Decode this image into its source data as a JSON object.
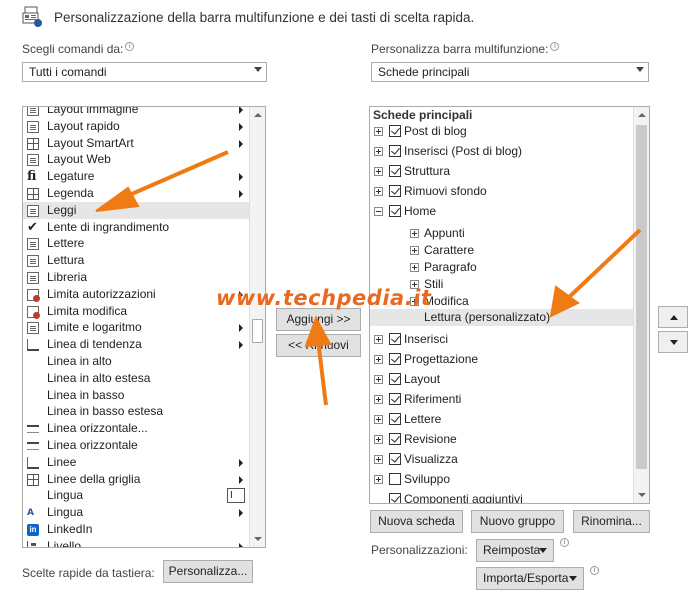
{
  "header": {
    "title": "Personalizzazione della barra multifunzione e dei tasti di scelta rapida."
  },
  "left": {
    "choose_label": "Scegli comandi da:",
    "combo_value": "Tutti i comandi",
    "items": [
      {
        "label": "Layout immagine",
        "icon": "image-layout-icon",
        "submenu": true
      },
      {
        "label": "Layout rapido",
        "icon": "quick-layout-icon",
        "submenu": true
      },
      {
        "label": "Layout SmartArt",
        "icon": "smartart-layout-icon",
        "submenu": true
      },
      {
        "label": "Layout Web",
        "icon": "web-layout-icon",
        "submenu": false
      },
      {
        "label": "Legature",
        "icon": "ligatures-icon",
        "submenu": true
      },
      {
        "label": "Legenda",
        "icon": "legend-icon",
        "submenu": true
      },
      {
        "label": "Leggi",
        "icon": "read-mode-icon",
        "submenu": false
      },
      {
        "label": "Lente di ingrandimento",
        "icon": "checkmark-icon",
        "submenu": false
      },
      {
        "label": "Lettere",
        "icon": "letters-icon",
        "submenu": false
      },
      {
        "label": "Lettura",
        "icon": "reading-icon",
        "submenu": false
      },
      {
        "label": "Libreria",
        "icon": "library-icon",
        "submenu": false
      },
      {
        "label": "Limita autorizzazioni",
        "icon": "restrict-permissions-icon",
        "submenu": true
      },
      {
        "label": "Limita modifica",
        "icon": "restrict-editing-icon",
        "submenu": false
      },
      {
        "label": "Limite e logaritmo",
        "icon": "limit-log-icon",
        "submenu": true
      },
      {
        "label": "Linea di tendenza",
        "icon": "trendline-icon",
        "submenu": true
      },
      {
        "label": "Linea in alto",
        "icon": "",
        "submenu": false
      },
      {
        "label": "Linea in alto estesa",
        "icon": "",
        "submenu": false
      },
      {
        "label": "Linea in basso",
        "icon": "",
        "submenu": false
      },
      {
        "label": "Linea in basso estesa",
        "icon": "",
        "submenu": false
      },
      {
        "label": "Linea orizzontale...",
        "icon": "horizontal-line-icon",
        "submenu": false
      },
      {
        "label": "Linea orizzontale",
        "icon": "horizontal-line-icon",
        "submenu": false
      },
      {
        "label": "Linee",
        "icon": "lines-icon",
        "submenu": true
      },
      {
        "label": "Linee della griglia",
        "icon": "gridlines-icon",
        "submenu": true
      },
      {
        "label": "Lingua",
        "icon": "",
        "submenu": false
      },
      {
        "label": "Lingua",
        "icon": "language-icon",
        "submenu": true
      },
      {
        "label": "LinkedIn",
        "icon": "linkedin-icon",
        "submenu": false
      },
      {
        "label": "Livello",
        "icon": "level-icon",
        "submenu": true
      }
    ],
    "selected_index": 6,
    "language_picker_glyph": "I"
  },
  "middle": {
    "add_button": "Aggiungi >>",
    "remove_button": "<< Rimuovi"
  },
  "right": {
    "customize_label": "Personalizza barra multifunzione:",
    "combo_value": "Schede principali",
    "tree_header": "Schede principali",
    "tree": [
      {
        "label": "Post di blog",
        "level": 0,
        "expander": "plus",
        "checkbox": "on"
      },
      {
        "label": "Inserisci (Post di blog)",
        "level": 0,
        "expander": "plus",
        "checkbox": "on"
      },
      {
        "label": "Struttura",
        "level": 0,
        "expander": "plus",
        "checkbox": "on"
      },
      {
        "label": "Rimuovi sfondo",
        "level": 0,
        "expander": "plus",
        "checkbox": "on"
      },
      {
        "label": "Home",
        "level": 0,
        "expander": "minus",
        "checkbox": "on"
      },
      {
        "label": "Appunti",
        "level": 1,
        "expander": "plus",
        "checkbox": "none"
      },
      {
        "label": "Carattere",
        "level": 1,
        "expander": "plus",
        "checkbox": "none"
      },
      {
        "label": "Paragrafo",
        "level": 1,
        "expander": "plus",
        "checkbox": "none"
      },
      {
        "label": "Stili",
        "level": 1,
        "expander": "plus",
        "checkbox": "none"
      },
      {
        "label": "Modifica",
        "level": 1,
        "expander": "plus",
        "checkbox": "none"
      },
      {
        "label": "Lettura (personalizzato)",
        "level": 2,
        "expander": "none",
        "checkbox": "none"
      },
      {
        "label": "Inserisci",
        "level": 0,
        "expander": "plus",
        "checkbox": "on"
      },
      {
        "label": "Progettazione",
        "level": 0,
        "expander": "plus",
        "checkbox": "on"
      },
      {
        "label": "Layout",
        "level": 0,
        "expander": "plus",
        "checkbox": "on"
      },
      {
        "label": "Riferimenti",
        "level": 0,
        "expander": "plus",
        "checkbox": "on"
      },
      {
        "label": "Lettere",
        "level": 0,
        "expander": "plus",
        "checkbox": "on"
      },
      {
        "label": "Revisione",
        "level": 0,
        "expander": "plus",
        "checkbox": "on"
      },
      {
        "label": "Visualizza",
        "level": 0,
        "expander": "plus",
        "checkbox": "on"
      },
      {
        "label": "Sviluppo",
        "level": 0,
        "expander": "plus",
        "checkbox": "off"
      },
      {
        "label": "Componenti aggiuntivi",
        "level": 0,
        "expander": "none",
        "checkbox": "on"
      }
    ],
    "selected_index": 10,
    "new_tab": "Nuova scheda",
    "new_group": "Nuovo gruppo",
    "rename": "Rinomina...",
    "customizations_label": "Personalizzazioni:",
    "reset": "Reimposta",
    "import_export": "Importa/Esporta"
  },
  "footer": {
    "shortcuts_label": "Scelte rapide da tastiera:",
    "customize_button": "Personalizza..."
  },
  "watermark": "www.techpedia.it",
  "colors": {
    "accent_arrow": "#f07a14",
    "selection": "#e6e6e6"
  }
}
